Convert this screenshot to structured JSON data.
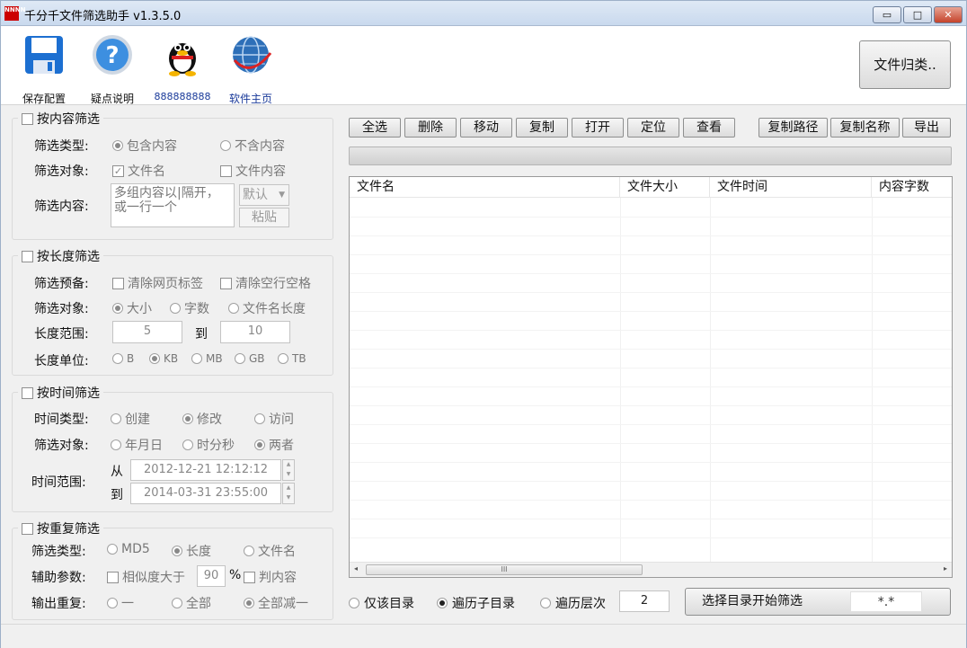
{
  "window": {
    "title": "千分千文件筛选助手 v1.3.5.0",
    "app_icon_text": "NNNN",
    "min": "▭",
    "max": "□",
    "close": "✕"
  },
  "toolbar": {
    "items": [
      {
        "label": "保存配置",
        "icon": "floppy-disk-icon"
      },
      {
        "label": "疑点说明",
        "icon": "help-icon"
      },
      {
        "label": "888888888",
        "icon": "qq-penguin-icon"
      },
      {
        "label": "软件主页",
        "icon": "globe-icon"
      }
    ],
    "sort_button": "文件归类.."
  },
  "content_filter": {
    "title": "按内容筛选",
    "checked": false,
    "type_label": "筛选类型:",
    "type_options": [
      "包含内容",
      "不含内容"
    ],
    "type_selected": 0,
    "target_label": "筛选对象:",
    "target_options": [
      "文件名",
      "文件内容"
    ],
    "target_checked": [
      true,
      false
    ],
    "content_label": "筛选内容:",
    "content_placeholder": "多组内容以|隔开，或一行一个",
    "mode_select": "默认",
    "paste_button": "粘贴"
  },
  "length_filter": {
    "title": "按长度筛选",
    "checked": false,
    "pre_label": "筛选预备:",
    "pre_options": [
      "清除网页标签",
      "清除空行空格"
    ],
    "target_label": "筛选对象:",
    "target_options": [
      "大小",
      "字数",
      "文件名长度"
    ],
    "target_selected": 0,
    "range_label": "长度范围:",
    "range_from": "5",
    "range_to_label": "到",
    "range_to": "10",
    "unit_label": "长度单位:",
    "units": [
      "B",
      "KB",
      "MB",
      "GB",
      "TB"
    ],
    "unit_selected": 1
  },
  "time_filter": {
    "title": "按时间筛选",
    "checked": false,
    "type_label": "时间类型:",
    "type_options": [
      "创建",
      "修改",
      "访问"
    ],
    "type_selected": 1,
    "target_label": "筛选对象:",
    "target_options": [
      "年月日",
      "时分秒",
      "两者"
    ],
    "target_selected": 2,
    "range_label": "时间范围:",
    "from_label": "从",
    "from_value": "2012-12-21 12:12:12",
    "to_label": "到",
    "to_value": "2014-03-31 23:55:00"
  },
  "dup_filter": {
    "title": "按重复筛选",
    "checked": false,
    "type_label": "筛选类型:",
    "type_options": [
      "MD5",
      "长度",
      "文件名"
    ],
    "type_selected": 1,
    "aux_label": "辅助参数:",
    "similar_label": "相似度大于",
    "similar_value": "90",
    "percent": "%",
    "judge_content": "判内容",
    "output_label": "输出重复:",
    "output_options": [
      "一",
      "全部",
      "全部减一"
    ],
    "output_selected": 2
  },
  "actions": [
    "全选",
    "删除",
    "移动",
    "复制",
    "打开",
    "定位",
    "查看",
    "复制路径",
    "复制名称",
    "导出"
  ],
  "table": {
    "columns": [
      "文件名",
      "文件大小",
      "文件时间",
      "内容字数"
    ],
    "rows": [],
    "scroll_grip": "III",
    "left_arrow": "◂",
    "right_arrow": "▸"
  },
  "scope": {
    "options": [
      "仅该目录",
      "遍历子目录",
      "遍历层次"
    ],
    "selected": 1,
    "depth": "2"
  },
  "start": {
    "label": "选择目录开始筛选",
    "pattern": "*.*"
  }
}
